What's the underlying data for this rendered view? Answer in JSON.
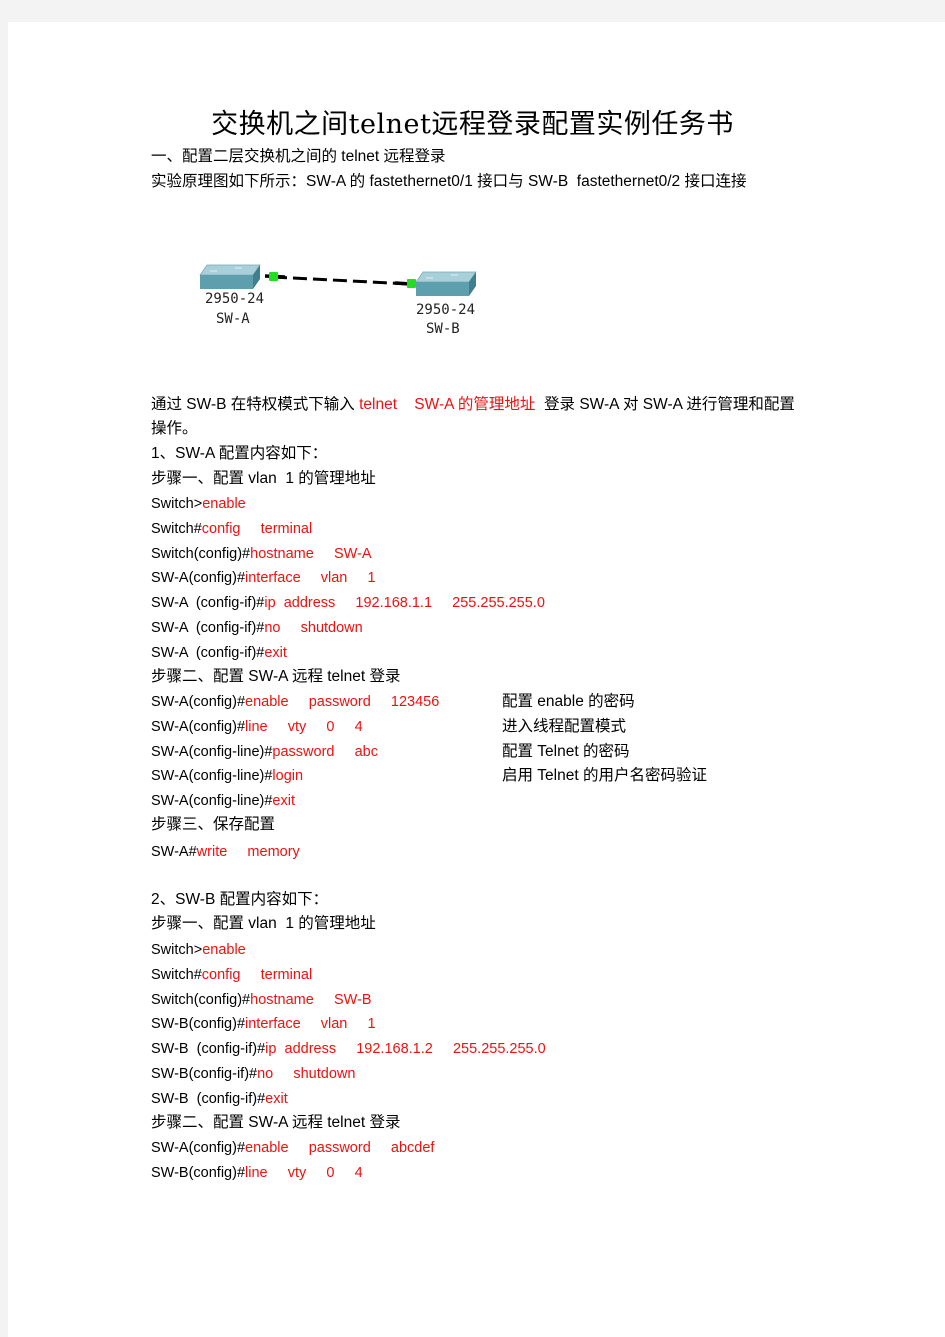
{
  "title": "交换机之间telnet远程登录配置实例任务书",
  "section1_heading": "一、配置二层交换机之间的 telnet 远程登录",
  "intro": "实验原理图如下所示：SW-A 的 fastethernet0/1 接口与 SW-B  fastethernet0/2 接口连接",
  "diagram": {
    "switch_a": {
      "model": "2950-24",
      "name": "SW-A"
    },
    "switch_b": {
      "model": "2950-24",
      "name": "SW-B"
    },
    "link_color": "#000000",
    "port_color": "#22dd22",
    "switch_color": "#6aaabb"
  },
  "description": {
    "part1": "通过 SW-B 在特权模式下输入 ",
    "red1": "telnet    SW-A 的管理地址",
    "part2": "  登录 SW-A 对 SW-A 进行管理和配置",
    "line2": "操作。"
  },
  "swa": {
    "heading": "1、SW-A 配置内容如下：",
    "step1": "步骤一、配置 vlan  1 的管理地址",
    "step1_cmds": [
      {
        "prompt": "Switch>",
        "cmd": "enable"
      },
      {
        "prompt": "Switch#",
        "cmd": "config     terminal"
      },
      {
        "prompt": "Switch(config)#",
        "cmd": "hostname     SW-A"
      },
      {
        "prompt": "SW-A(config)#",
        "cmd": "interface     vlan     1"
      },
      {
        "prompt": "SW-A  (config-if)#",
        "cmd": "ip  address     192.168.1.1     255.255.255.0"
      },
      {
        "prompt": "SW-A  (config-if)#",
        "cmd": "no     shutdown"
      },
      {
        "prompt": "SW-A  (config-if)#",
        "cmd": "exit"
      }
    ],
    "step2": "步骤二、配置 SW-A 远程 telnet 登录",
    "step2_cmds": [
      {
        "prompt": "SW-A(config)#",
        "cmd": "enable     password     123456",
        "note": "配置 enable 的密码"
      },
      {
        "prompt": "SW-A(config)#",
        "cmd": "line     vty     0     4",
        "note": "进入线程配置模式"
      },
      {
        "prompt": "SW-A(config-line)#",
        "cmd": "password     abc",
        "note": "配置 Telnet 的密码"
      },
      {
        "prompt": "SW-A(config-line)#",
        "cmd": "login",
        "note": "启用 Telnet 的用户名密码验证"
      },
      {
        "prompt": "SW-A(config-line)#",
        "cmd": "exit",
        "note": ""
      }
    ],
    "step3": "步骤三、保存配置",
    "step3_cmds": [
      {
        "prompt": "SW-A#",
        "cmd": "write     memory"
      }
    ]
  },
  "swb": {
    "heading": "2、SW-B 配置内容如下：",
    "step1": "步骤一、配置 vlan  1 的管理地址",
    "step1_cmds": [
      {
        "prompt": "Switch>",
        "cmd": "enable"
      },
      {
        "prompt": "Switch#",
        "cmd": "config     terminal"
      },
      {
        "prompt": "Switch(config)#",
        "cmd": "hostname     SW-B"
      },
      {
        "prompt": "SW-B(config)#",
        "cmd": "interface     vlan     1"
      },
      {
        "prompt": "SW-B  (config-if)#",
        "cmd": "ip  address     192.168.1.2     255.255.255.0"
      },
      {
        "prompt": "SW-B(config-if)#",
        "cmd": "no     shutdown"
      },
      {
        "prompt": "SW-B  (config-if)#",
        "cmd": "exit"
      }
    ],
    "step2": "步骤二、配置 SW-A 远程 telnet 登录",
    "step2_cmds": [
      {
        "prompt": "SW-A(config)#",
        "cmd": "enable     password     abcdef"
      },
      {
        "prompt": "SW-B(config)#",
        "cmd": "line     vty     0     4"
      }
    ]
  }
}
